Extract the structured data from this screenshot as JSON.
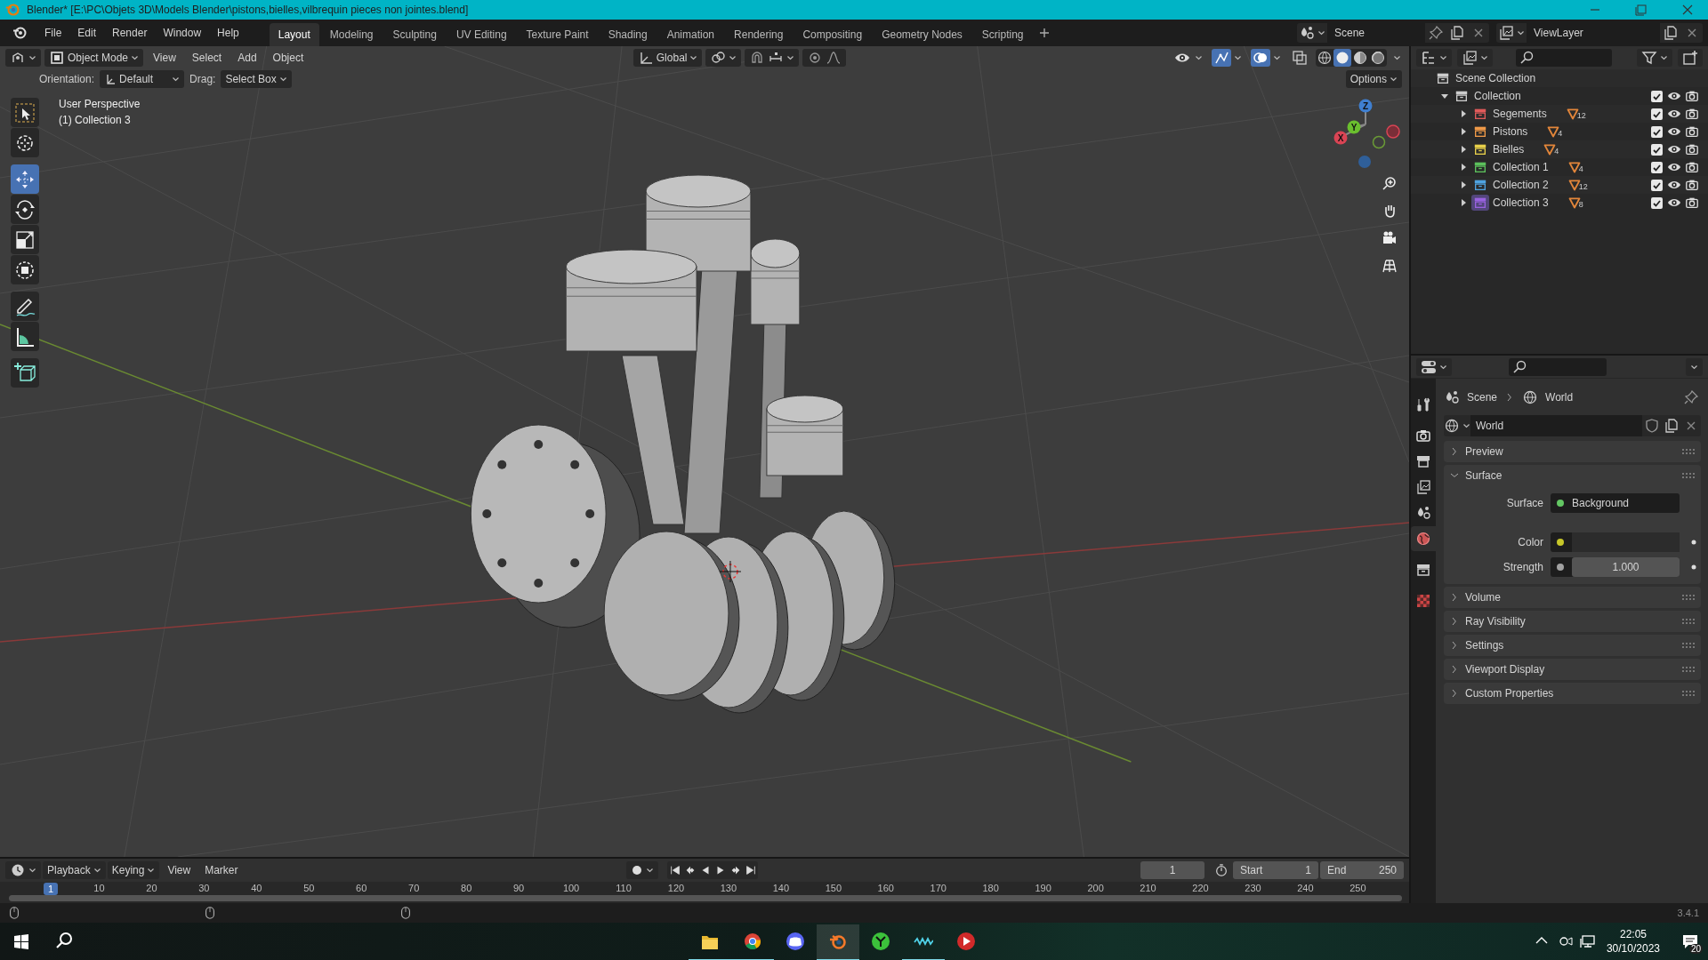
{
  "window": {
    "title": "Blender* [E:\\PC\\Objets 3D\\Models Blender\\pistons,bielles,vilbrequin pieces non jointes.blend]"
  },
  "menus": [
    "File",
    "Edit",
    "Render",
    "Window",
    "Help"
  ],
  "workspaces": [
    {
      "label": "Layout",
      "selected": true
    },
    {
      "label": "Modeling",
      "selected": false
    },
    {
      "label": "Sculpting",
      "selected": false
    },
    {
      "label": "UV Editing",
      "selected": false
    },
    {
      "label": "Texture Paint",
      "selected": false
    },
    {
      "label": "Shading",
      "selected": false
    },
    {
      "label": "Animation",
      "selected": false
    },
    {
      "label": "Rendering",
      "selected": false
    },
    {
      "label": "Compositing",
      "selected": false
    },
    {
      "label": "Geometry Nodes",
      "selected": false
    },
    {
      "label": "Scripting",
      "selected": false
    }
  ],
  "scene": {
    "name": "Scene",
    "view_layer": "ViewLayer"
  },
  "viewport": {
    "mode": "Object Mode",
    "menus": [
      "View",
      "Select",
      "Add",
      "Object"
    ],
    "transform_orientation": "Global",
    "orientation_label": "Orientation:",
    "orientation": "Default",
    "drag_label": "Drag:",
    "drag": "Select Box",
    "options": "Options",
    "toggles": [
      {
        "kind": "visibility",
        "on": false
      },
      {
        "kind": "gizmo",
        "on": true
      },
      {
        "kind": "overlay",
        "on": true
      },
      {
        "kind": "xray",
        "on": false
      }
    ],
    "shading": [
      {
        "kind": "wireframe",
        "selected": false
      },
      {
        "kind": "solid",
        "selected": true
      },
      {
        "kind": "material",
        "selected": false
      },
      {
        "kind": "rendered",
        "selected": false
      }
    ],
    "info": [
      "User Perspective",
      "(1) Collection 3"
    ],
    "tools": [
      {
        "kind": "select",
        "selected": false
      },
      {
        "kind": "cursor",
        "selected": false
      },
      {
        "kind": "move",
        "selected": true
      },
      {
        "kind": "rotate",
        "selected": false
      },
      {
        "kind": "scale",
        "selected": false
      },
      {
        "kind": "transform",
        "selected": false
      },
      {
        "kind": "annotate",
        "selected": false
      },
      {
        "kind": "measure",
        "selected": false
      },
      {
        "kind": "add_cube",
        "selected": false
      }
    ],
    "axes": [
      "X",
      "Y",
      "Z"
    ]
  },
  "outliner": {
    "items": [
      {
        "label": "Scene Collection",
        "children": [
          {
            "label": "Collection",
            "expanded": true,
            "checked": true,
            "children": [
              {
                "label": "Segements",
                "color": "#e05a5a",
                "count": "12",
                "expanded": false,
                "checked": true,
                "active": false
              },
              {
                "label": "Pistons",
                "color": "#f09a48",
                "count": "4",
                "expanded": false,
                "checked": true,
                "active": false
              },
              {
                "label": "Bielles",
                "color": "#e8d04a",
                "count": "4",
                "expanded": false,
                "checked": true,
                "active": false
              },
              {
                "label": "Collection 1",
                "color": "#5cc05c",
                "count": "4",
                "expanded": false,
                "checked": true,
                "active": false
              },
              {
                "label": "Collection 2",
                "color": "#4fa3e0",
                "count": "12",
                "expanded": false,
                "checked": true,
                "active": false
              },
              {
                "label": "Collection 3",
                "color": "#9a62e0",
                "count": "8",
                "expanded": false,
                "checked": true,
                "active": true
              }
            ]
          }
        ]
      }
    ]
  },
  "properties": {
    "tabs": [
      {
        "kind": "tool",
        "selected": false
      },
      {
        "kind": "render",
        "selected": false
      },
      {
        "kind": "output",
        "selected": false
      },
      {
        "kind": "view_layer",
        "selected": false
      },
      {
        "kind": "scene",
        "selected": false
      },
      {
        "kind": "world",
        "selected": true
      },
      {
        "kind": "collection",
        "selected": false
      },
      {
        "kind": "texture",
        "selected": false
      }
    ],
    "breadcrumb": [
      "Scene",
      "World"
    ],
    "datablock": "World",
    "panels": [
      {
        "label": "Preview",
        "expanded": false
      },
      {
        "label": "Surface",
        "expanded": true,
        "fields": [
          {
            "label": "Surface",
            "kind": "shader",
            "value": "Background",
            "color": "#63c763"
          },
          {
            "label": "Color",
            "kind": "color",
            "color": "#c7c729"
          },
          {
            "label": "Strength",
            "kind": "number",
            "value": "1.000",
            "color": "#a1a1a1"
          }
        ]
      },
      {
        "label": "Volume",
        "expanded": false
      },
      {
        "label": "Ray Visibility",
        "expanded": false
      },
      {
        "label": "Settings",
        "expanded": false
      },
      {
        "label": "Viewport Display",
        "expanded": false
      },
      {
        "label": "Custom Properties",
        "expanded": false
      }
    ]
  },
  "timeline": {
    "menus": [
      {
        "label": "Playback",
        "kind": "dropdown"
      },
      {
        "label": "Keying",
        "kind": "dropdown"
      },
      {
        "label": "View",
        "kind": "menu"
      },
      {
        "label": "Marker",
        "kind": "menu"
      }
    ],
    "frame": "1",
    "start_label": "Start",
    "start": "1",
    "end_label": "End",
    "end": "250",
    "playhead": "1",
    "ruler": [
      "10",
      "20",
      "30",
      "40",
      "50",
      "60",
      "70",
      "80",
      "90",
      "100",
      "110",
      "120",
      "130",
      "140",
      "150",
      "160",
      "170",
      "180",
      "190",
      "200",
      "210",
      "220",
      "230",
      "240",
      "250"
    ]
  },
  "status_bar": {
    "version": "3.4.1"
  },
  "taskbar": {
    "apps": [
      {
        "kind": "folder",
        "running": true,
        "active": false
      },
      {
        "kind": "browser",
        "running": true,
        "active": false
      },
      {
        "kind": "chat",
        "running": false,
        "active": false
      },
      {
        "kind": "blender",
        "running": true,
        "active": true
      },
      {
        "kind": "branch",
        "running": false,
        "active": false
      },
      {
        "kind": "wave",
        "running": true,
        "active": false
      },
      {
        "kind": "play",
        "running": false,
        "active": false
      }
    ],
    "time": "22:05",
    "date": "30/10/2023",
    "notifications": "20"
  }
}
